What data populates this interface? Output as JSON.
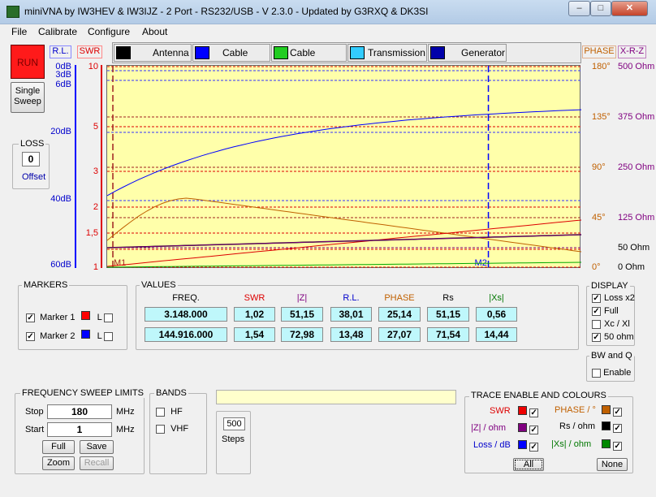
{
  "window": {
    "title": "miniVNA by IW3HEV & IW3IJZ - 2 Port - RS232/USB - V 2.3.0 - Updated by G3RXQ & DK3SI"
  },
  "menu": [
    "File",
    "Calibrate",
    "Configure",
    "About"
  ],
  "controls": {
    "run": "RUN",
    "single_sweep_1": "Single",
    "single_sweep_2": "Sweep",
    "loss_title": "LOSS",
    "loss_value": "0",
    "offset": "Offset"
  },
  "tabs": [
    "Antenna",
    "Cable Loss",
    "Cable Length",
    "Transmission",
    "Generator"
  ],
  "axis_headers": {
    "rl": "R.L.",
    "swr": "SWR",
    "phase": "PHASE",
    "xrz": "X-R-Z"
  },
  "chart_data": {
    "type": "line",
    "x": {
      "start_mhz": 1,
      "stop_mhz": 180
    },
    "markers": [
      {
        "name": "M1",
        "freq_mhz": 3.148
      },
      {
        "name": "M2",
        "freq_mhz": 144.916
      }
    ],
    "left_rl_ticks": [
      "0dB",
      "3dB",
      "6dB",
      "20dB",
      "40dB",
      "60dB"
    ],
    "left_swr_ticks": [
      "10",
      "5",
      "3",
      "2",
      "1,5",
      "1"
    ],
    "right_phase_ticks": [
      "180°",
      "135°",
      "90°",
      "45°",
      "0°"
    ],
    "right_ohm_ticks": [
      "500 Ohm",
      "375 Ohm",
      "250 Ohm",
      "125 Ohm",
      "50 Ohm",
      "0 Ohm"
    ],
    "colors": {
      "swr": "#dd0000",
      "phase": "#c06000",
      "rl": "#0000ff",
      "rs": "#000000",
      "xs": "#007700",
      "z": "#800080"
    }
  },
  "markers_panel": {
    "title": "MARKERS",
    "m1": "Marker 1",
    "m2": "Marker 2",
    "l": "L"
  },
  "values": {
    "title": "VALUES",
    "headers": [
      "FREQ.",
      "SWR",
      "|Z|",
      "R.L.",
      "PHASE",
      "Rs",
      "|Xs|"
    ],
    "rows": [
      [
        "3.148.000",
        "1,02",
        "51,15",
        "38,01",
        "25,14",
        "51,15",
        "0,56"
      ],
      [
        "144.916.000",
        "1,54",
        "72,98",
        "13,48",
        "27,07",
        "71,54",
        "14,44"
      ]
    ]
  },
  "display": {
    "title": "DISPLAY",
    "items": [
      "Loss x2",
      "Full",
      "Xc / Xl",
      "50 ohm"
    ],
    "checked": [
      true,
      true,
      false,
      true
    ],
    "bwq_title": "BW and Q",
    "enable": "Enable"
  },
  "sweep": {
    "title": "FREQUENCY SWEEP LIMITS",
    "stop_label": "Stop",
    "stop": "180",
    "start_label": "Start",
    "start": "1",
    "unit": "MHz",
    "full": "Full",
    "save": "Save",
    "zoom": "Zoom",
    "recall": "Recall"
  },
  "bands": {
    "title": "BANDS",
    "hf": "HF",
    "vhf": "VHF"
  },
  "steps": {
    "value": "500",
    "label": "Steps"
  },
  "trace": {
    "title": "TRACE ENABLE AND COLOURS",
    "swr": "SWR",
    "z": "|Z| / ohm",
    "loss": "Loss / dB",
    "phase": "PHASE / °",
    "rs": "Rs / ohm",
    "xs": "|Xs| / ohm",
    "all": "All",
    "none": "None"
  }
}
